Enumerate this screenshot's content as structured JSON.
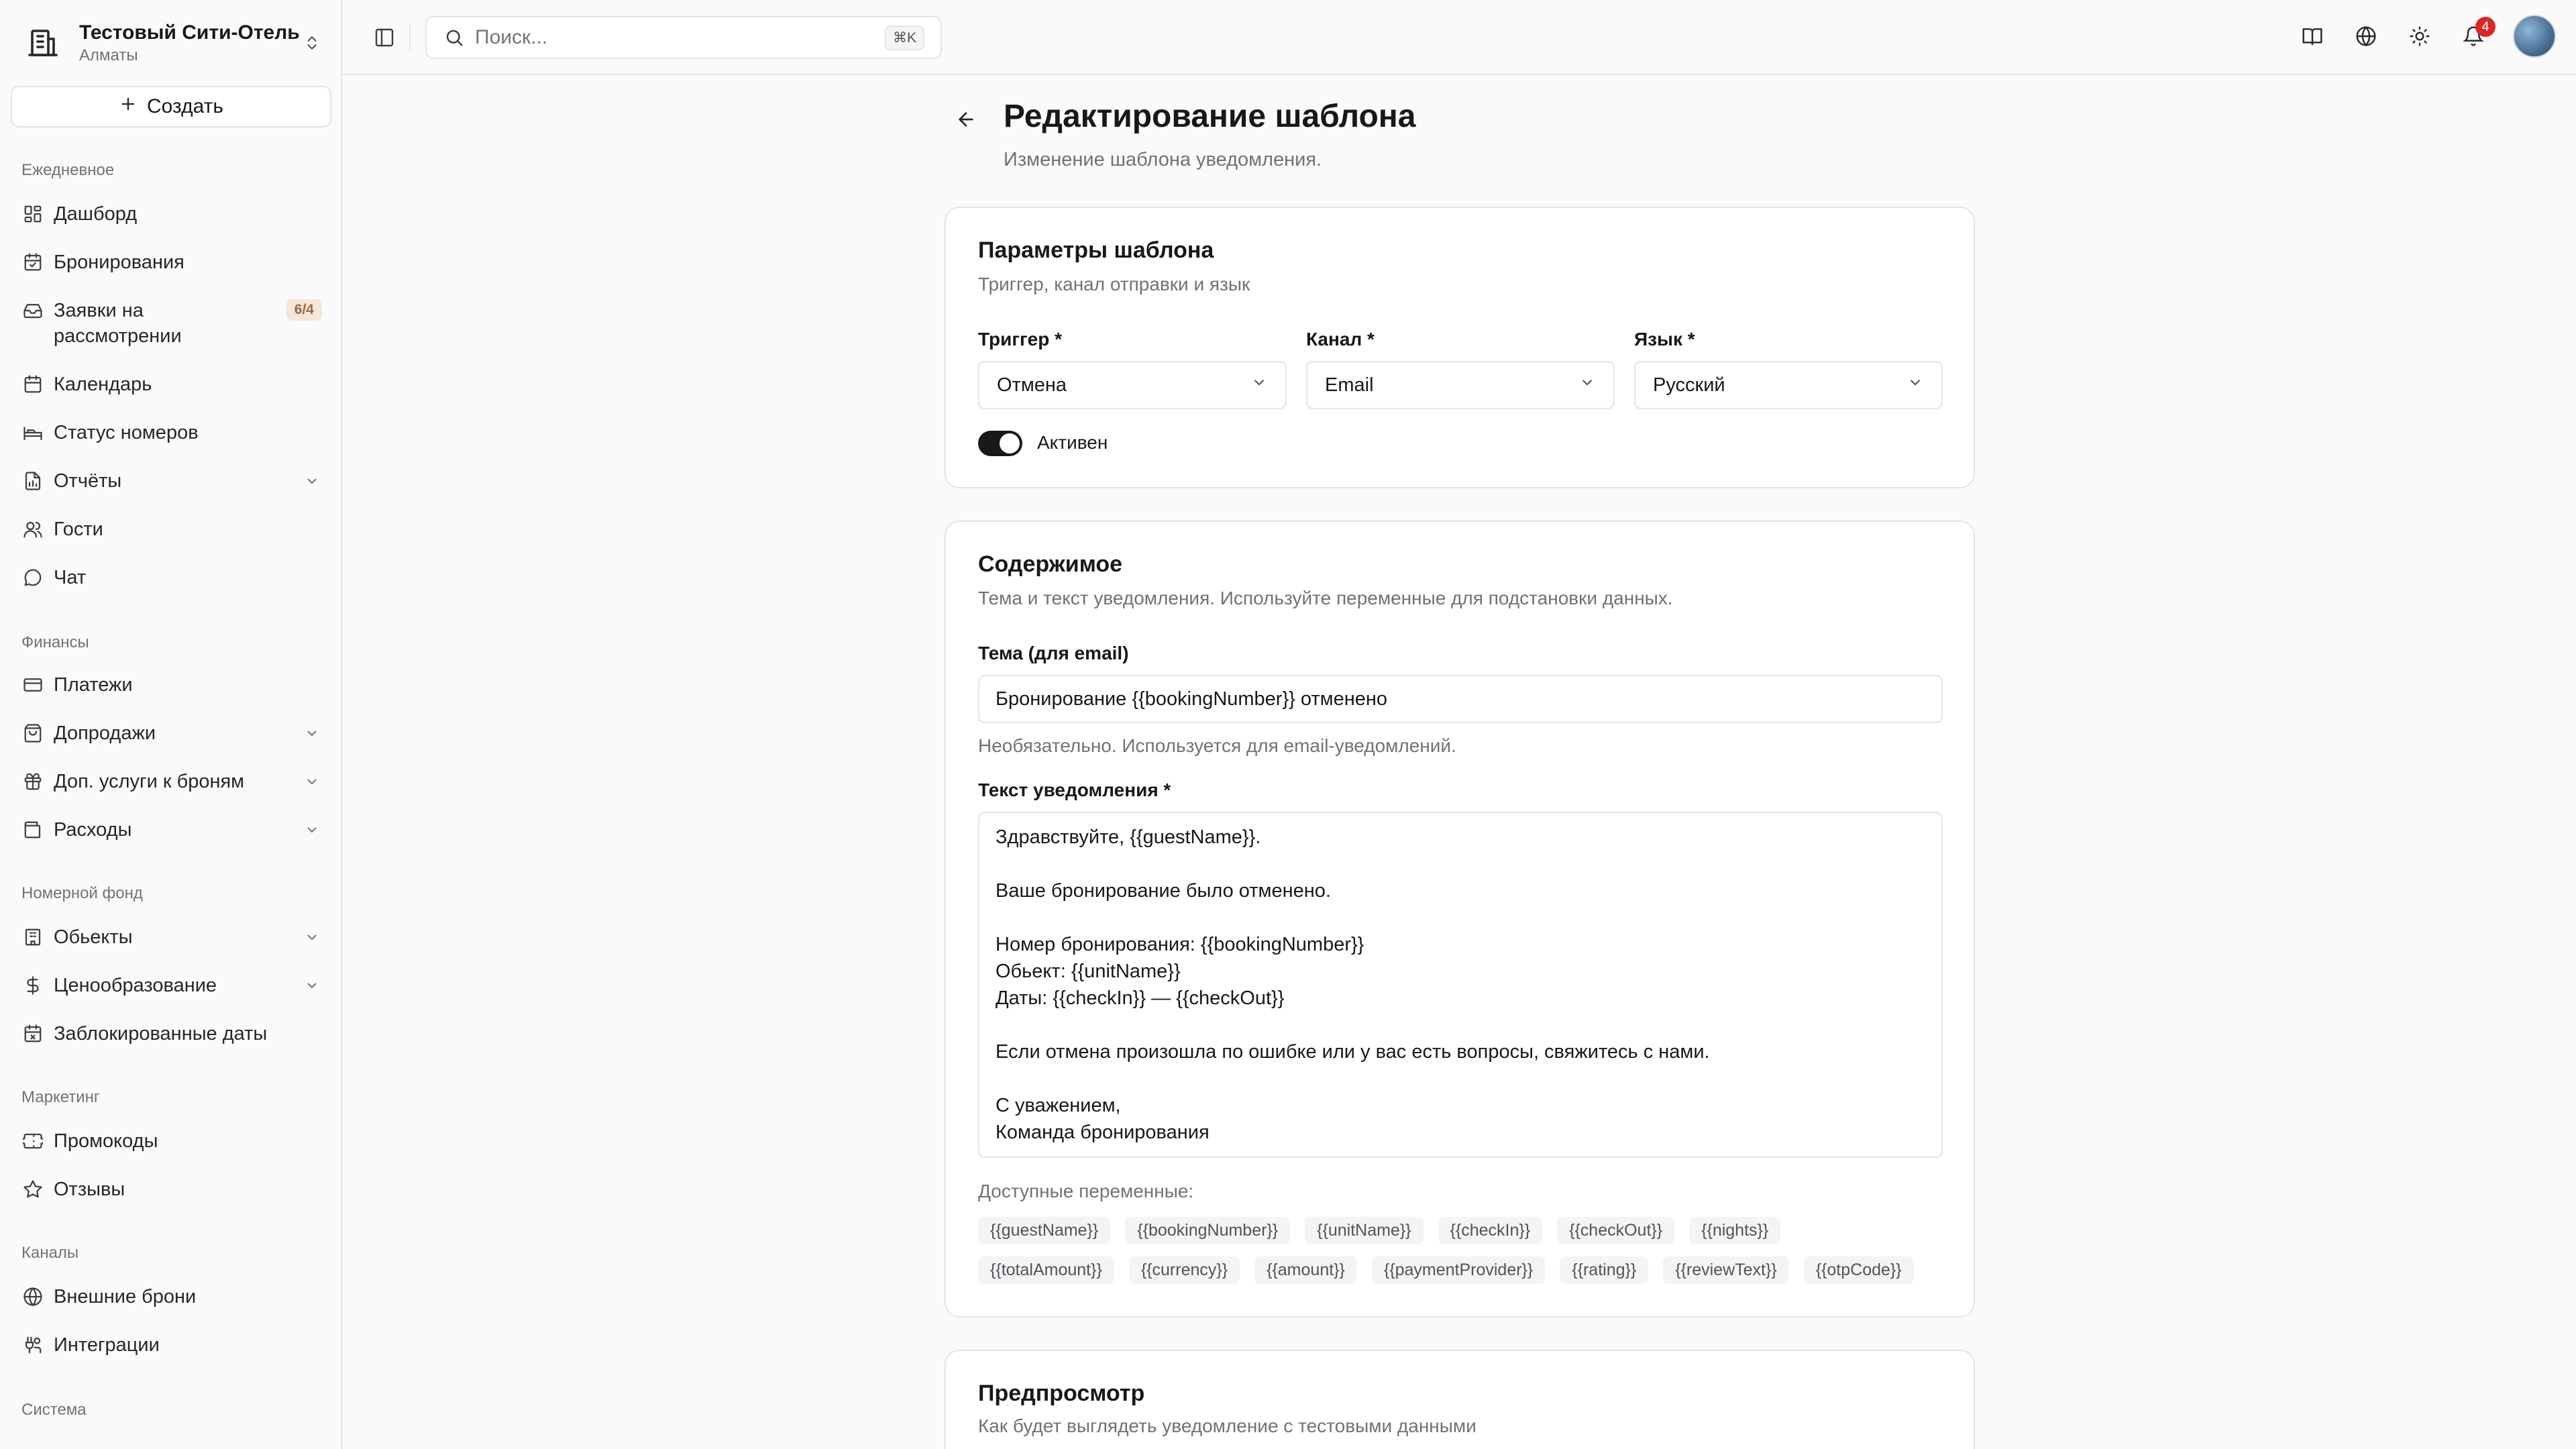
{
  "org": {
    "name": "Тестовый Сити-Отель",
    "city": "Алматы"
  },
  "create_label": "Создать",
  "sidebar": {
    "sections": {
      "daily": "Ежедневное",
      "finance": "Финансы",
      "rooms": "Номерной фонд",
      "marketing": "Маркетинг",
      "channels": "Каналы",
      "system": "Система"
    },
    "items": [
      {
        "label": "Дашборд"
      },
      {
        "label": "Бронирования"
      },
      {
        "label": "Заявки на рассмотрении",
        "badge": "6/4"
      },
      {
        "label": "Календарь"
      },
      {
        "label": "Статус номеров"
      },
      {
        "label": "Отчёты"
      },
      {
        "label": "Гости"
      },
      {
        "label": "Чат"
      },
      {
        "label": "Платежи"
      },
      {
        "label": "Допродажи"
      },
      {
        "label": "Доп. услуги к броням"
      },
      {
        "label": "Расходы"
      },
      {
        "label": "Обьекты"
      },
      {
        "label": "Ценообразование"
      },
      {
        "label": "Заблокированные даты"
      },
      {
        "label": "Промокоды"
      },
      {
        "label": "Отзывы"
      },
      {
        "label": "Внешние брони"
      },
      {
        "label": "Интеграции"
      }
    ]
  },
  "search": {
    "placeholder": "Поиск...",
    "shortcut": "⌘K"
  },
  "notifications_count": "4",
  "page": {
    "title": "Редактирование шаблона",
    "subtitle": "Изменение шаблона уведомления."
  },
  "params_card": {
    "title": "Параметры шаблона",
    "desc": "Триггер, канал отправки и язык",
    "trigger_label": "Триггер *",
    "trigger_value": "Отмена",
    "channel_label": "Канал *",
    "channel_value": "Email",
    "language_label": "Язык *",
    "language_value": "Русский",
    "active_label": "Активен"
  },
  "content_card": {
    "title": "Содержимое",
    "desc": "Тема и текст уведомления. Используйте переменные для подстановки данных.",
    "subject_label": "Тема (для email)",
    "subject_value": "Бронирование {{bookingNumber}} отменено",
    "subject_hint": "Необязательно. Используется для email-уведомлений.",
    "body_label": "Текст уведомления *",
    "body_value": "Здравствуйте, {{guestName}}.\n\nВаше бронирование было отменено.\n\nНомер бронирования: {{bookingNumber}}\nОбьект: {{unitName}}\nДаты: {{checkIn}} — {{checkOut}}\n\nЕсли отмена произошла по ошибке или у вас есть вопросы, свяжитесь с нами.\n\nС уважением,\nКоманда бронирования",
    "vars_label": "Доступные переменные:",
    "vars": [
      "{{guestName}}",
      "{{bookingNumber}}",
      "{{unitName}}",
      "{{checkIn}}",
      "{{checkOut}}",
      "{{nights}}",
      "{{totalAmount}}",
      "{{currency}}",
      "{{amount}}",
      "{{paymentProvider}}",
      "{{rating}}",
      "{{reviewText}}",
      "{{otpCode}}"
    ]
  },
  "preview_card": {
    "title": "Предпросмотр",
    "desc": "Как будет выглядеть уведомление с тестовыми данными"
  }
}
